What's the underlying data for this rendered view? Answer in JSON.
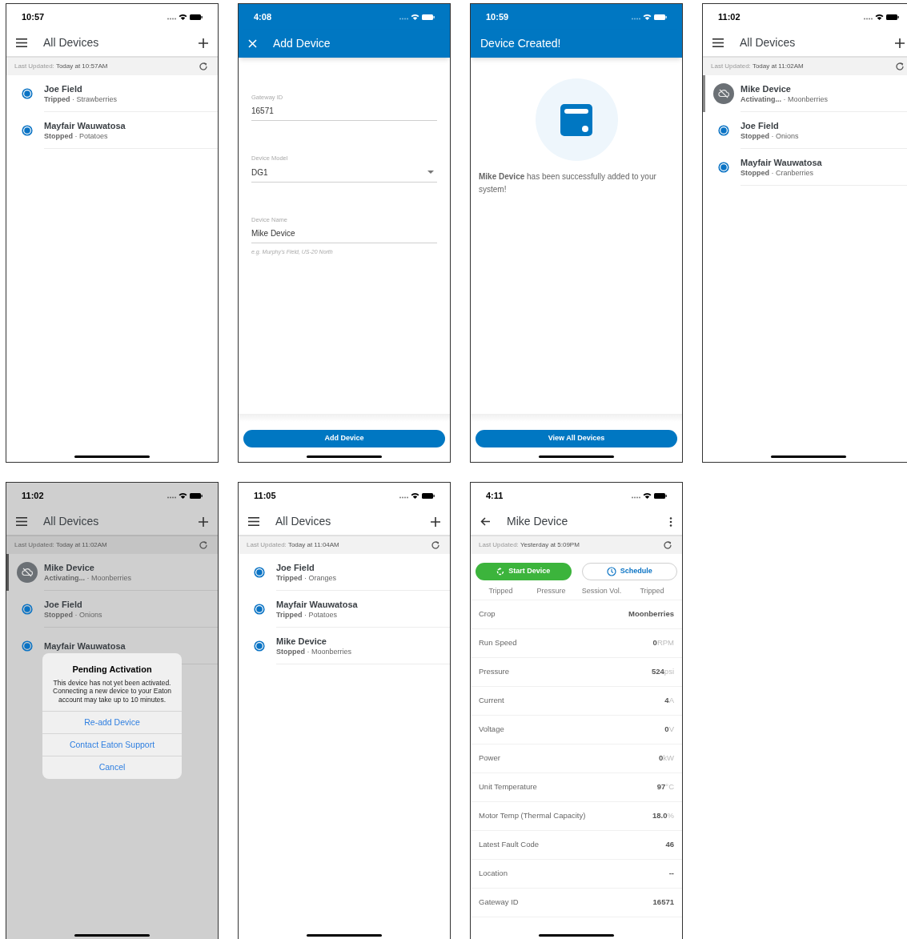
{
  "screens": [
    {
      "kind": "list",
      "dimmed": false,
      "status_time": "10:57",
      "header": {
        "title": "All Devices"
      },
      "last_updated": {
        "label": "Last Updated:",
        "value": "Today at 10:57AM"
      },
      "devices": [
        {
          "name": "Joe Field",
          "subtitle": "**Tripped** · Strawberries",
          "kind": "online",
          "selected": false
        },
        {
          "name": "Mayfair Wauwatosa",
          "subtitle": "**Stopped** · Potatoes",
          "kind": "online",
          "selected": false
        }
      ]
    },
    {
      "kind": "form",
      "status_time": "4:08",
      "header": {
        "title": "Add Device"
      },
      "fields": [
        {
          "label": "Gateway ID",
          "value": "16571",
          "kind": "text"
        },
        {
          "label": "Device Model",
          "value": "DG1",
          "kind": "select"
        },
        {
          "label": "Device Name",
          "value": "Mike Device",
          "kind": "text",
          "hint": "e.g. Murphy's Field, US-20 North"
        }
      ],
      "button": "Add Device"
    },
    {
      "kind": "confirmation",
      "status_time": "10:59",
      "header": {
        "title": "Device Created!"
      },
      "message": "**Mike Device** has been successfully added to your system!",
      "button": "View All Devices"
    },
    {
      "kind": "list",
      "dimmed": false,
      "status_time": "11:02",
      "header": {
        "title": "All Devices"
      },
      "last_updated": {
        "label": "Last Updated:",
        "value": "Today at 11:02AM"
      },
      "devices": [
        {
          "name": "Mike Device",
          "subtitle": "**Activating...** · Moonberries",
          "kind": "offline",
          "selected": true
        },
        {
          "name": "Joe Field",
          "subtitle": "**Stopped** · Onions",
          "kind": "online",
          "selected": false
        },
        {
          "name": "Mayfair Wauwatosa",
          "subtitle": "**Stopped** · Cranberries",
          "kind": "online",
          "selected": false
        }
      ]
    },
    {
      "kind": "list",
      "dimmed": true,
      "status_time": "11:02",
      "header": {
        "title": "All Devices"
      },
      "last_updated": {
        "label": "Last Updated:",
        "value": "Today at 11:02AM"
      },
      "devices": [
        {
          "name": "Mike Device",
          "subtitle": "**Activating...** · Moonberries",
          "kind": "offline",
          "selected": true
        },
        {
          "name": "Joe Field",
          "subtitle": "**Stopped** · Onions",
          "kind": "online",
          "selected": false
        },
        {
          "name": "Mayfair Wauwatosa",
          "kind": "online",
          "selected": false
        }
      ],
      "dialog": {
        "title": "Pending Activation",
        "message": "This device has not yet been activated. Connecting a new device to your Eaton account may take up to 10 minutes.",
        "actions": [
          "Re-add Device",
          "Contact Eaton Support",
          "Cancel"
        ]
      }
    },
    {
      "kind": "list",
      "dimmed": false,
      "status_time": "11:05",
      "header": {
        "title": "All Devices"
      },
      "last_updated": {
        "label": "Last Updated:",
        "value": "Today at 11:04AM"
      },
      "devices": [
        {
          "name": "Joe Field",
          "subtitle": "**Tripped** · Oranges",
          "kind": "online",
          "selected": false
        },
        {
          "name": "Mayfair Wauwatosa",
          "subtitle": "**Tripped** · Potatoes",
          "kind": "online",
          "selected": false
        },
        {
          "name": "Mike Device",
          "subtitle": "**Stopped** · Moonberries",
          "kind": "online",
          "selected": false
        }
      ]
    },
    {
      "kind": "detail",
      "status_time": "4:11",
      "header": {
        "title": "Mike Device"
      },
      "last_updated": {
        "label": "Last Updated:",
        "value": "Yesterday at 5:09PM"
      },
      "actions": [
        {
          "label": "Start Device",
          "kind": "primary"
        },
        {
          "label": "Schedule",
          "kind": "outline"
        }
      ],
      "stat_labels": [
        "Tripped",
        "Pressure",
        "Session Vol.",
        "Tripped"
      ],
      "rows": [
        {
          "label": "Crop",
          "value": "Moonberries"
        },
        {
          "label": "Run Speed",
          "value": "0",
          "unit": "RPM"
        },
        {
          "label": "Pressure",
          "value": "524",
          "unit": "psi"
        },
        {
          "label": "Current",
          "value": "4",
          "unit": "A"
        },
        {
          "label": "Voltage",
          "value": "0",
          "unit": "V"
        },
        {
          "label": "Power",
          "value": "0",
          "unit": "kW"
        },
        {
          "label": "Unit Temperature",
          "value": "97",
          "unit": "°C"
        },
        {
          "label": "Motor Temp (Thermal Capacity)",
          "value": "18.0",
          "unit": "%"
        },
        {
          "label": "Latest Fault Code",
          "value": "46"
        },
        {
          "label": "Location",
          "value": "--"
        },
        {
          "label": "Gateway ID",
          "value": "16571"
        }
      ]
    }
  ]
}
